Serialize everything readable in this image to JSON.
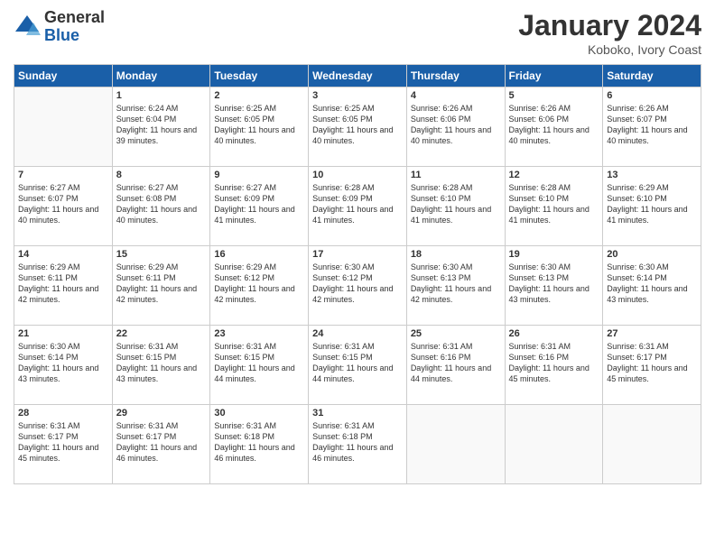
{
  "header": {
    "logo_general": "General",
    "logo_blue": "Blue",
    "month_title": "January 2024",
    "location": "Koboko, Ivory Coast"
  },
  "days_of_week": [
    "Sunday",
    "Monday",
    "Tuesday",
    "Wednesday",
    "Thursday",
    "Friday",
    "Saturday"
  ],
  "weeks": [
    [
      {
        "day": "",
        "sunrise": "",
        "sunset": "",
        "daylight": ""
      },
      {
        "day": "1",
        "sunrise": "Sunrise: 6:24 AM",
        "sunset": "Sunset: 6:04 PM",
        "daylight": "Daylight: 11 hours and 39 minutes."
      },
      {
        "day": "2",
        "sunrise": "Sunrise: 6:25 AM",
        "sunset": "Sunset: 6:05 PM",
        "daylight": "Daylight: 11 hours and 40 minutes."
      },
      {
        "day": "3",
        "sunrise": "Sunrise: 6:25 AM",
        "sunset": "Sunset: 6:05 PM",
        "daylight": "Daylight: 11 hours and 40 minutes."
      },
      {
        "day": "4",
        "sunrise": "Sunrise: 6:26 AM",
        "sunset": "Sunset: 6:06 PM",
        "daylight": "Daylight: 11 hours and 40 minutes."
      },
      {
        "day": "5",
        "sunrise": "Sunrise: 6:26 AM",
        "sunset": "Sunset: 6:06 PM",
        "daylight": "Daylight: 11 hours and 40 minutes."
      },
      {
        "day": "6",
        "sunrise": "Sunrise: 6:26 AM",
        "sunset": "Sunset: 6:07 PM",
        "daylight": "Daylight: 11 hours and 40 minutes."
      }
    ],
    [
      {
        "day": "7",
        "sunrise": "Sunrise: 6:27 AM",
        "sunset": "Sunset: 6:07 PM",
        "daylight": "Daylight: 11 hours and 40 minutes."
      },
      {
        "day": "8",
        "sunrise": "Sunrise: 6:27 AM",
        "sunset": "Sunset: 6:08 PM",
        "daylight": "Daylight: 11 hours and 40 minutes."
      },
      {
        "day": "9",
        "sunrise": "Sunrise: 6:27 AM",
        "sunset": "Sunset: 6:09 PM",
        "daylight": "Daylight: 11 hours and 41 minutes."
      },
      {
        "day": "10",
        "sunrise": "Sunrise: 6:28 AM",
        "sunset": "Sunset: 6:09 PM",
        "daylight": "Daylight: 11 hours and 41 minutes."
      },
      {
        "day": "11",
        "sunrise": "Sunrise: 6:28 AM",
        "sunset": "Sunset: 6:10 PM",
        "daylight": "Daylight: 11 hours and 41 minutes."
      },
      {
        "day": "12",
        "sunrise": "Sunrise: 6:28 AM",
        "sunset": "Sunset: 6:10 PM",
        "daylight": "Daylight: 11 hours and 41 minutes."
      },
      {
        "day": "13",
        "sunrise": "Sunrise: 6:29 AM",
        "sunset": "Sunset: 6:10 PM",
        "daylight": "Daylight: 11 hours and 41 minutes."
      }
    ],
    [
      {
        "day": "14",
        "sunrise": "Sunrise: 6:29 AM",
        "sunset": "Sunset: 6:11 PM",
        "daylight": "Daylight: 11 hours and 42 minutes."
      },
      {
        "day": "15",
        "sunrise": "Sunrise: 6:29 AM",
        "sunset": "Sunset: 6:11 PM",
        "daylight": "Daylight: 11 hours and 42 minutes."
      },
      {
        "day": "16",
        "sunrise": "Sunrise: 6:29 AM",
        "sunset": "Sunset: 6:12 PM",
        "daylight": "Daylight: 11 hours and 42 minutes."
      },
      {
        "day": "17",
        "sunrise": "Sunrise: 6:30 AM",
        "sunset": "Sunset: 6:12 PM",
        "daylight": "Daylight: 11 hours and 42 minutes."
      },
      {
        "day": "18",
        "sunrise": "Sunrise: 6:30 AM",
        "sunset": "Sunset: 6:13 PM",
        "daylight": "Daylight: 11 hours and 42 minutes."
      },
      {
        "day": "19",
        "sunrise": "Sunrise: 6:30 AM",
        "sunset": "Sunset: 6:13 PM",
        "daylight": "Daylight: 11 hours and 43 minutes."
      },
      {
        "day": "20",
        "sunrise": "Sunrise: 6:30 AM",
        "sunset": "Sunset: 6:14 PM",
        "daylight": "Daylight: 11 hours and 43 minutes."
      }
    ],
    [
      {
        "day": "21",
        "sunrise": "Sunrise: 6:30 AM",
        "sunset": "Sunset: 6:14 PM",
        "daylight": "Daylight: 11 hours and 43 minutes."
      },
      {
        "day": "22",
        "sunrise": "Sunrise: 6:31 AM",
        "sunset": "Sunset: 6:15 PM",
        "daylight": "Daylight: 11 hours and 43 minutes."
      },
      {
        "day": "23",
        "sunrise": "Sunrise: 6:31 AM",
        "sunset": "Sunset: 6:15 PM",
        "daylight": "Daylight: 11 hours and 44 minutes."
      },
      {
        "day": "24",
        "sunrise": "Sunrise: 6:31 AM",
        "sunset": "Sunset: 6:15 PM",
        "daylight": "Daylight: 11 hours and 44 minutes."
      },
      {
        "day": "25",
        "sunrise": "Sunrise: 6:31 AM",
        "sunset": "Sunset: 6:16 PM",
        "daylight": "Daylight: 11 hours and 44 minutes."
      },
      {
        "day": "26",
        "sunrise": "Sunrise: 6:31 AM",
        "sunset": "Sunset: 6:16 PM",
        "daylight": "Daylight: 11 hours and 45 minutes."
      },
      {
        "day": "27",
        "sunrise": "Sunrise: 6:31 AM",
        "sunset": "Sunset: 6:17 PM",
        "daylight": "Daylight: 11 hours and 45 minutes."
      }
    ],
    [
      {
        "day": "28",
        "sunrise": "Sunrise: 6:31 AM",
        "sunset": "Sunset: 6:17 PM",
        "daylight": "Daylight: 11 hours and 45 minutes."
      },
      {
        "day": "29",
        "sunrise": "Sunrise: 6:31 AM",
        "sunset": "Sunset: 6:17 PM",
        "daylight": "Daylight: 11 hours and 46 minutes."
      },
      {
        "day": "30",
        "sunrise": "Sunrise: 6:31 AM",
        "sunset": "Sunset: 6:18 PM",
        "daylight": "Daylight: 11 hours and 46 minutes."
      },
      {
        "day": "31",
        "sunrise": "Sunrise: 6:31 AM",
        "sunset": "Sunset: 6:18 PM",
        "daylight": "Daylight: 11 hours and 46 minutes."
      },
      {
        "day": "",
        "sunrise": "",
        "sunset": "",
        "daylight": ""
      },
      {
        "day": "",
        "sunrise": "",
        "sunset": "",
        "daylight": ""
      },
      {
        "day": "",
        "sunrise": "",
        "sunset": "",
        "daylight": ""
      }
    ]
  ]
}
